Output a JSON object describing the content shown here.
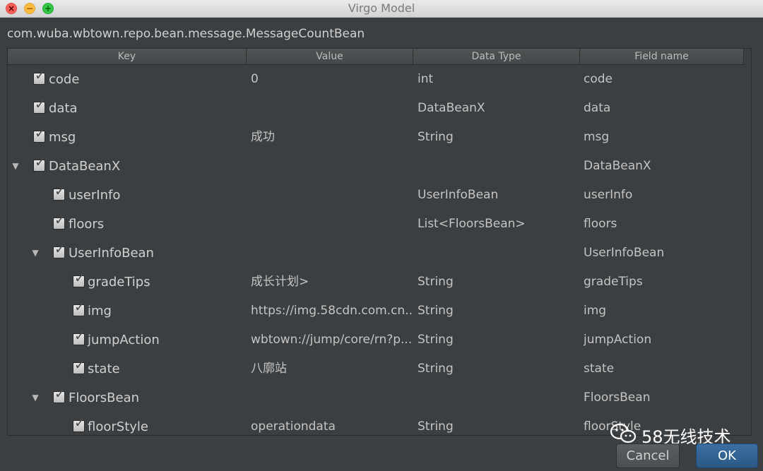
{
  "window": {
    "title": "Virgo Model"
  },
  "class_path": "com.wuba.wbtown.repo.bean.message.MessageCountBean",
  "table": {
    "columns": [
      "Key",
      "Value",
      "Data Type",
      "Field name"
    ],
    "rows": [
      {
        "indent": 0,
        "expandable": false,
        "checked": true,
        "key": "code",
        "value": "0",
        "type": "int",
        "field": "code"
      },
      {
        "indent": 0,
        "expandable": false,
        "checked": true,
        "key": "data",
        "value": "",
        "type": "DataBeanX",
        "field": "data"
      },
      {
        "indent": 0,
        "expandable": false,
        "checked": true,
        "key": "msg",
        "value": "成功",
        "type": "String",
        "field": "msg"
      },
      {
        "indent": 0,
        "expandable": true,
        "checked": true,
        "key": "DataBeanX",
        "value": "",
        "type": "",
        "field": "DataBeanX"
      },
      {
        "indent": 1,
        "expandable": false,
        "checked": true,
        "key": "userInfo",
        "value": "",
        "type": "UserInfoBean",
        "field": "userInfo"
      },
      {
        "indent": 1,
        "expandable": false,
        "checked": true,
        "key": "floors",
        "value": "",
        "type": "List<FloorsBean>",
        "field": "floors"
      },
      {
        "indent": 1,
        "expandable": true,
        "checked": true,
        "key": "UserInfoBean",
        "value": "",
        "type": "",
        "field": "UserInfoBean"
      },
      {
        "indent": 2,
        "expandable": false,
        "checked": true,
        "key": "gradeTips",
        "value": "成长计划>",
        "type": "String",
        "field": "gradeTips"
      },
      {
        "indent": 2,
        "expandable": false,
        "checked": true,
        "key": "img",
        "value": "https://img.58cdn.com.cn...",
        "type": "String",
        "field": "img"
      },
      {
        "indent": 2,
        "expandable": false,
        "checked": true,
        "key": "jumpAction",
        "value": "wbtown://jump/core/rn?p...",
        "type": "String",
        "field": "jumpAction"
      },
      {
        "indent": 2,
        "expandable": false,
        "checked": true,
        "key": "state",
        "value": "八廓站",
        "type": "String",
        "field": "state"
      },
      {
        "indent": 1,
        "expandable": true,
        "checked": true,
        "key": "FloorsBean",
        "value": "",
        "type": "",
        "field": "FloorsBean"
      },
      {
        "indent": 2,
        "expandable": false,
        "checked": true,
        "key": "floorStyle",
        "value": "operationdata",
        "type": "String",
        "field": "floorStyle"
      }
    ]
  },
  "buttons": {
    "cancel": "Cancel",
    "ok": "OK"
  },
  "watermark": "58无线技术",
  "icons": {
    "expand": "chevron-down-icon",
    "check": "checkmark-icon",
    "logo": "wechat-icon"
  },
  "colors": {
    "background": "#3c3f41",
    "ok_button": "#2c5984",
    "close": "#fc605b",
    "minimize": "#fdbc40",
    "maximize": "#34c84a"
  }
}
